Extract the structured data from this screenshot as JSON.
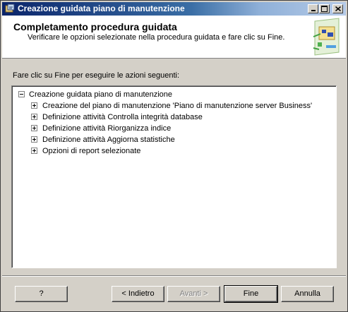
{
  "window": {
    "title": "Creazione guidata piano di manutenzione"
  },
  "header": {
    "title": "Completamento procedura guidata",
    "subtitle": "Verificare le opzioni selezionate nella procedura guidata e fare clic su Fine."
  },
  "instructions": "Fare clic su Fine per eseguire le azioni seguenti:",
  "tree": {
    "root": "Creazione guidata piano di manutenzione",
    "items": [
      "Creazione del piano di manutenzione 'Piano di manutenzione server Business'",
      "Definizione attività Controlla integrità database",
      "Definizione attività Riorganizza indice",
      "Definizione attività Aggiorna statistiche",
      "Opzioni di report selezionate"
    ]
  },
  "buttons": {
    "help": "?",
    "back": "< Indietro",
    "next": "Avanti >",
    "finish": "Fine",
    "cancel": "Annulla"
  }
}
